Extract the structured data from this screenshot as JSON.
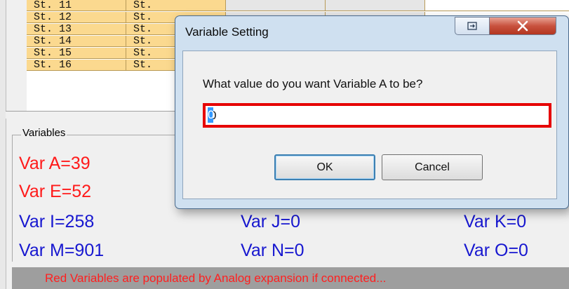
{
  "stations": {
    "rows": [
      {
        "c1": "St. 11",
        "c2": "St."
      },
      {
        "c1": "St. 12",
        "c2": "St."
      },
      {
        "c1": "St. 13",
        "c2": "St."
      },
      {
        "c1": "St. 14",
        "c2": "St."
      },
      {
        "c1": "St. 15",
        "c2": "St."
      },
      {
        "c1": "St. 16",
        "c2": "St."
      }
    ]
  },
  "variables": {
    "legend": "Variables",
    "items": [
      {
        "label": "Var A=39",
        "color": "red"
      },
      {
        "label": "Var E=52",
        "color": "red"
      },
      {
        "label": "Var I=258",
        "color": "blue"
      },
      {
        "label": "Var J=0",
        "color": "blue"
      },
      {
        "label": "Var K=0",
        "color": "blue"
      },
      {
        "label": "Var M=901",
        "color": "blue"
      },
      {
        "label": "Var N=0",
        "color": "blue"
      },
      {
        "label": "Var O=0",
        "color": "blue"
      }
    ],
    "footer_note": "Red Variables are populated by Analog expansion if connected..."
  },
  "dialog": {
    "title": "Variable Setting",
    "prompt": "What value do you want Variable A to be?",
    "input_value": "0",
    "ok_label": "OK",
    "cancel_label": "Cancel",
    "icons": [
      "restore-icon",
      "close-icon"
    ]
  },
  "colors": {
    "red_var": "#ff1a1a",
    "blue_var": "#1717d0",
    "station_cell": "#fbd98f",
    "input_border": "#e60000"
  }
}
